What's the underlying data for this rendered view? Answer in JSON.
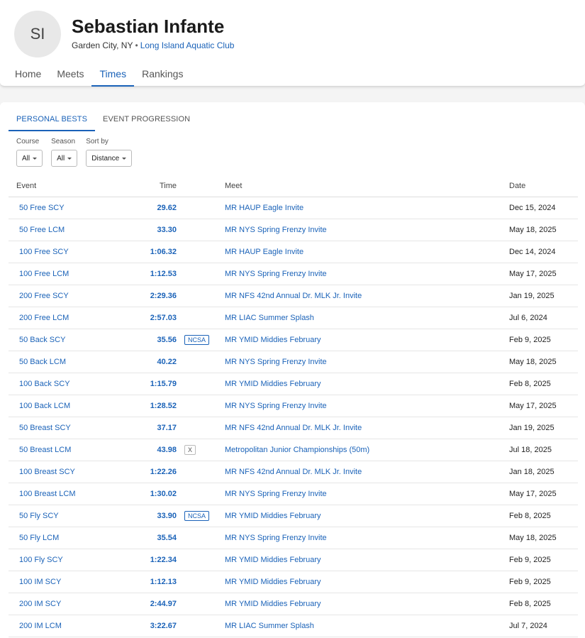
{
  "profile": {
    "initials": "SI",
    "name": "Sebastian Infante",
    "location": "Garden City, NY",
    "separator": "•",
    "club": "Long Island Aquatic Club"
  },
  "nav": [
    {
      "label": "Home"
    },
    {
      "label": "Meets"
    },
    {
      "label": "Times",
      "active": true
    },
    {
      "label": "Rankings"
    }
  ],
  "subtabs": [
    {
      "label": "PERSONAL BESTS",
      "active": true
    },
    {
      "label": "EVENT PROGRESSION"
    }
  ],
  "filters": [
    {
      "label": "Course",
      "value": "All"
    },
    {
      "label": "Season",
      "value": "All"
    },
    {
      "label": "Sort by",
      "value": "Distance"
    }
  ],
  "table": {
    "headers": {
      "event": "Event",
      "time": "Time",
      "meet": "Meet",
      "date": "Date"
    },
    "rows": [
      {
        "event": "50 Free SCY",
        "time": "29.62",
        "badge": "",
        "meet": "MR HAUP Eagle Invite",
        "date": "Dec 15, 2024"
      },
      {
        "event": "50 Free LCM",
        "time": "33.30",
        "badge": "",
        "meet": "MR NYS Spring Frenzy Invite",
        "date": "May 18, 2025"
      },
      {
        "event": "100 Free SCY",
        "time": "1:06.32",
        "badge": "",
        "meet": "MR HAUP Eagle Invite",
        "date": "Dec 14, 2024"
      },
      {
        "event": "100 Free LCM",
        "time": "1:12.53",
        "badge": "",
        "meet": "MR NYS Spring Frenzy Invite",
        "date": "May 17, 2025"
      },
      {
        "event": "200 Free SCY",
        "time": "2:29.36",
        "badge": "",
        "meet": "MR NFS 42nd Annual Dr. MLK Jr. Invite",
        "date": "Jan 19, 2025"
      },
      {
        "event": "200 Free LCM",
        "time": "2:57.03",
        "badge": "",
        "meet": "MR LIAC Summer Splash",
        "date": "Jul 6, 2024"
      },
      {
        "event": "50 Back SCY",
        "time": "35.56",
        "badge": "NCSA",
        "meet": "MR YMID Middies February",
        "date": "Feb 9, 2025"
      },
      {
        "event": "50 Back LCM",
        "time": "40.22",
        "badge": "",
        "meet": "MR NYS Spring Frenzy Invite",
        "date": "May 18, 2025"
      },
      {
        "event": "100 Back SCY",
        "time": "1:15.79",
        "badge": "",
        "meet": "MR YMID Middies February",
        "date": "Feb 8, 2025"
      },
      {
        "event": "100 Back LCM",
        "time": "1:28.52",
        "badge": "",
        "meet": "MR NYS Spring Frenzy Invite",
        "date": "May 17, 2025"
      },
      {
        "event": "50 Breast SCY",
        "time": "37.17",
        "badge": "",
        "meet": "MR NFS 42nd Annual Dr. MLK Jr. Invite",
        "date": "Jan 19, 2025"
      },
      {
        "event": "50 Breast LCM",
        "time": "43.98",
        "badge": "X",
        "meet": "Metropolitan Junior Championships (50m)",
        "date": "Jul 18, 2025"
      },
      {
        "event": "100 Breast SCY",
        "time": "1:22.26",
        "badge": "",
        "meet": "MR NFS 42nd Annual Dr. MLK Jr. Invite",
        "date": "Jan 18, 2025"
      },
      {
        "event": "100 Breast LCM",
        "time": "1:30.02",
        "badge": "",
        "meet": "MR NYS Spring Frenzy Invite",
        "date": "May 17, 2025"
      },
      {
        "event": "50 Fly SCY",
        "time": "33.90",
        "badge": "NCSA",
        "meet": "MR YMID Middies February",
        "date": "Feb 8, 2025"
      },
      {
        "event": "50 Fly LCM",
        "time": "35.54",
        "badge": "",
        "meet": "MR NYS Spring Frenzy Invite",
        "date": "May 18, 2025"
      },
      {
        "event": "100 Fly SCY",
        "time": "1:22.34",
        "badge": "",
        "meet": "MR YMID Middies February",
        "date": "Feb 9, 2025"
      },
      {
        "event": "100 IM SCY",
        "time": "1:12.13",
        "badge": "",
        "meet": "MR YMID Middies February",
        "date": "Feb 9, 2025"
      },
      {
        "event": "200 IM SCY",
        "time": "2:44.97",
        "badge": "",
        "meet": "MR YMID Middies February",
        "date": "Feb 8, 2025"
      },
      {
        "event": "200 IM LCM",
        "time": "3:22.67",
        "badge": "",
        "meet": "MR LIAC Summer Splash",
        "date": "Jul 7, 2024"
      }
    ]
  },
  "colors": {
    "accent": "#1a62b8",
    "background": "#f4f4f4"
  }
}
